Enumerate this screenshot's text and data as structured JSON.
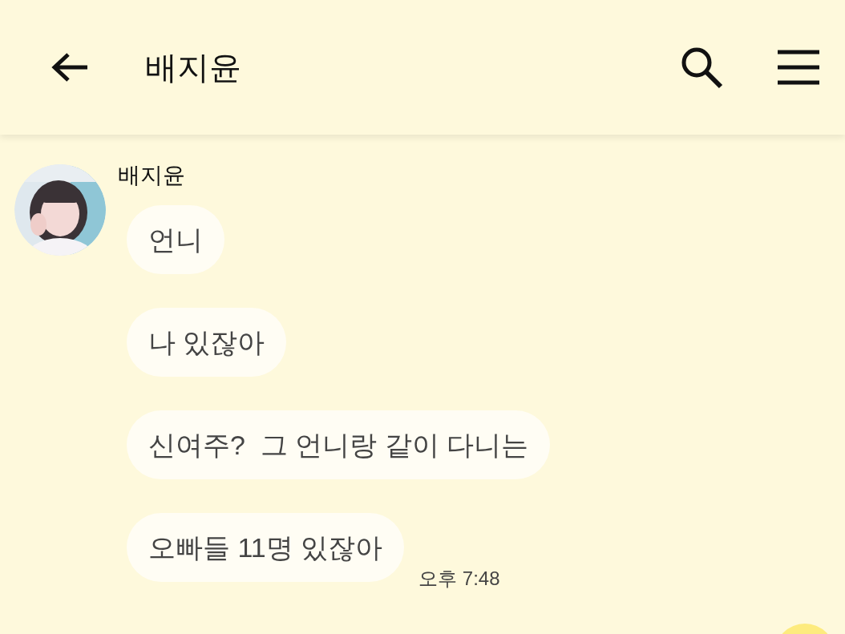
{
  "header": {
    "title": "배지윤"
  },
  "chat": {
    "sender": "배지윤",
    "messages": [
      {
        "text": "언니"
      },
      {
        "text": "나 있잖아"
      },
      {
        "text": "신여주?  그 언니랑 같이 다니는"
      },
      {
        "text": "오빠들 11명 있잖아"
      }
    ],
    "time": "오후 7:48"
  }
}
